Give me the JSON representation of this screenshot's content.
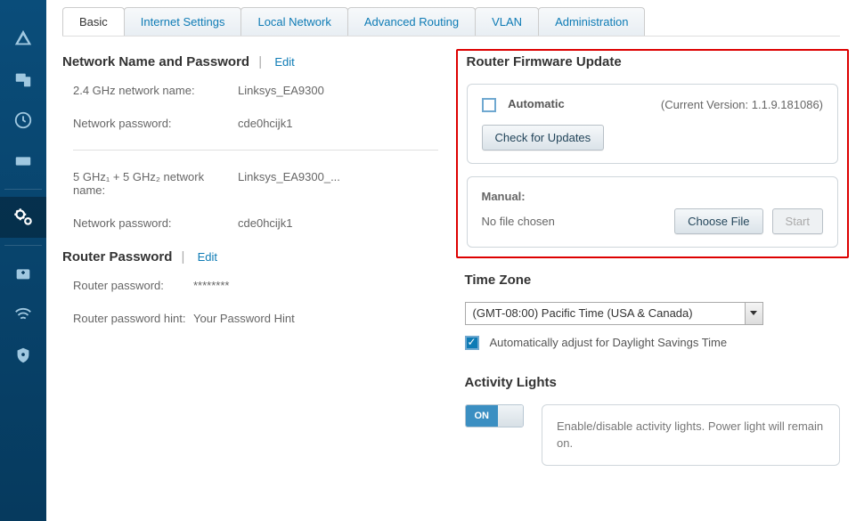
{
  "tabs": [
    "Basic",
    "Internet Settings",
    "Local Network",
    "Advanced Routing",
    "VLAN",
    "Administration"
  ],
  "network": {
    "title": "Network Name and Password",
    "edit": "Edit",
    "r1_label": "2.4 GHz network name:",
    "r1_value": "Linksys_EA9300",
    "r2_label": "Network password:",
    "r2_value": "cde0hcijk1",
    "r3_label": "5 GHz₁ + 5 GHz₂ network name:",
    "r3_value": "Linksys_EA9300_...",
    "r4_label": "Network password:",
    "r4_value": "cde0hcijk1"
  },
  "routerpw": {
    "title": "Router Password",
    "edit": "Edit",
    "r1_label": "Router password:",
    "r1_value": "********",
    "r2_label": "Router password hint:",
    "r2_value": "Your Password Hint"
  },
  "firmware": {
    "title": "Router Firmware Update",
    "auto_label": "Automatic",
    "version": "(Current Version: 1.1.9.181086)",
    "check_btn": "Check for Updates",
    "manual_label": "Manual:",
    "no_file": "No file chosen",
    "choose_btn": "Choose File",
    "start_btn": "Start"
  },
  "timezone": {
    "title": "Time Zone",
    "selected": "(GMT-08:00) Pacific Time (USA & Canada)",
    "dst": "Automatically adjust for Daylight Savings Time"
  },
  "activity": {
    "title": "Activity Lights",
    "on": "ON",
    "desc": "Enable/disable activity lights. Power light will remain on."
  }
}
